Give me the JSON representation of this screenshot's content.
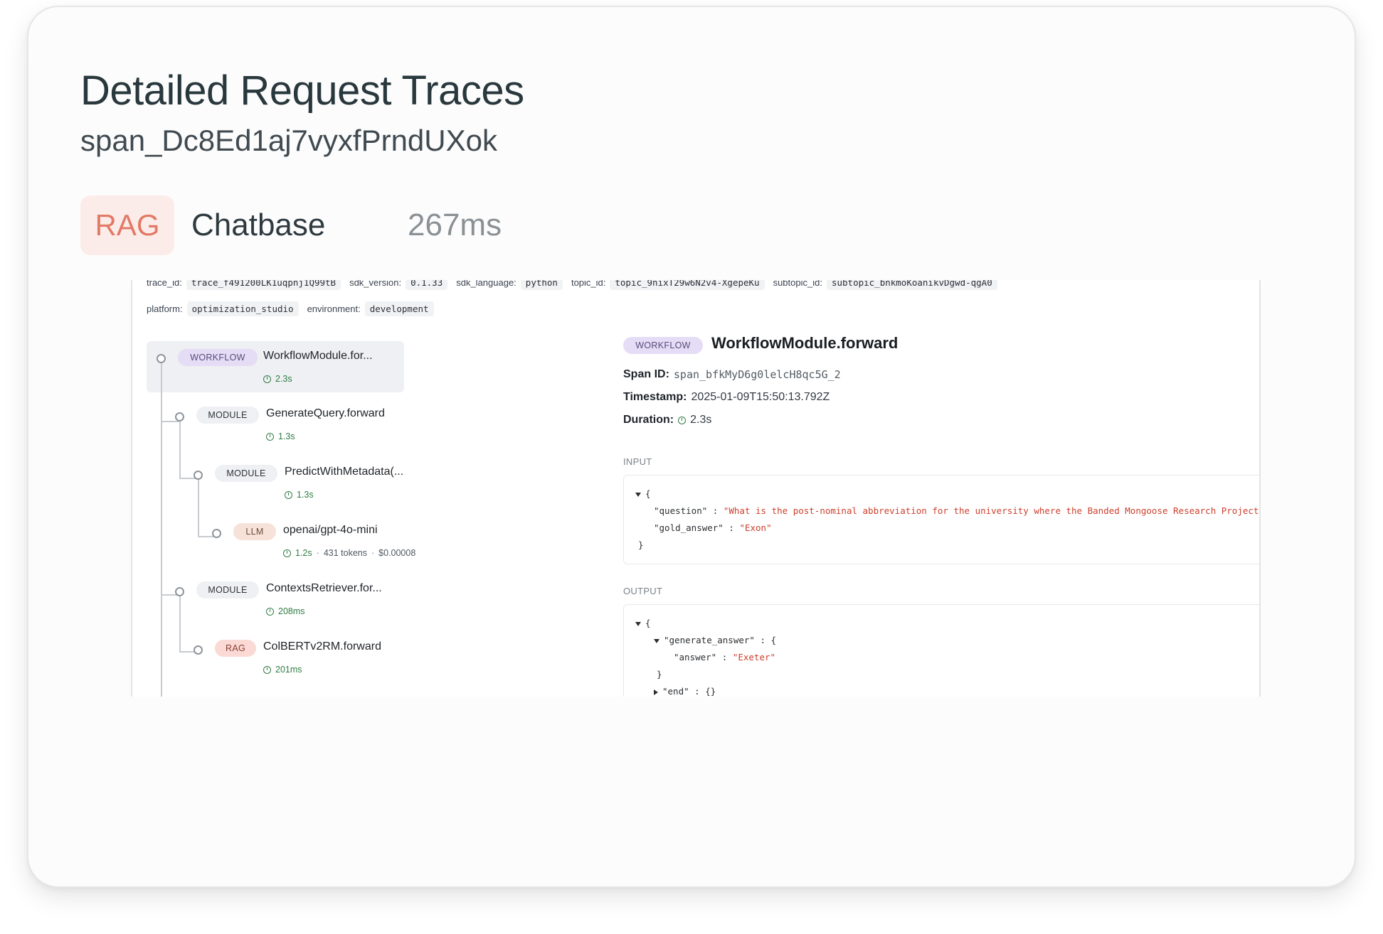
{
  "header": {
    "title": "Detailed Request Traces",
    "span_id": "span_Dc8Ed1aj7vyxfPrndUXok",
    "type_tag": "RAG",
    "app_name": "Chatbase",
    "latency": "267ms"
  },
  "meta": {
    "row1": [
      {
        "key": "trace_id:",
        "value": "trace_f491200LK1uqpnj1Q99tB"
      },
      {
        "key": "sdk_version:",
        "value": "0.1.33"
      },
      {
        "key": "sdk_language:",
        "value": "python"
      },
      {
        "key": "topic_id:",
        "value": "topic_9nixT29w6N2v4-XgepeKu"
      },
      {
        "key": "subtopic_id:",
        "value": "subtopic_bnkmoKoanikvDgwd-qgA0"
      }
    ],
    "row2": [
      {
        "key": "platform:",
        "value": "optimization_studio"
      },
      {
        "key": "environment:",
        "value": "development"
      }
    ]
  },
  "tree": {
    "nodes": [
      {
        "type": "WORKFLOW",
        "name": "WorkflowModule.for...",
        "duration": "2.3s"
      },
      {
        "type": "MODULE",
        "name": "GenerateQuery.forward",
        "duration": "1.3s"
      },
      {
        "type": "MODULE",
        "name": "PredictWithMetadata(...",
        "duration": "1.3s"
      },
      {
        "type": "LLM",
        "name": "openai/gpt-4o-mini",
        "duration": "1.2s",
        "tokens": "431 tokens",
        "cost": "$0.00008"
      },
      {
        "type": "MODULE",
        "name": "ContextsRetriever.for...",
        "duration": "208ms"
      },
      {
        "type": "RAG",
        "name": "ColBERTv2RM.forward",
        "duration": "201ms"
      }
    ],
    "separator": "·"
  },
  "detail": {
    "type": "WORKFLOW",
    "title": "WorkflowModule.forward",
    "span_id_label": "Span ID:",
    "span_id": "span_bfkMyD6g0lelcH8qc5G_2",
    "timestamp_label": "Timestamp:",
    "timestamp": "2025-01-09T15:50:13.792Z",
    "duration_label": "Duration:",
    "duration": "2.3s",
    "input_label": "INPUT",
    "output_label": "OUTPUT",
    "input": {
      "open_brace": "{",
      "close_brace": "}",
      "question_key": "\"question\"",
      "question_val": "\"What is the post-nominal abbreviation for the university where the Banded Mongoose Research Project is based?\"",
      "gold_key": "\"gold_answer\"",
      "gold_val": "\"Exon\"",
      "colon": ":"
    },
    "output": {
      "open_brace": "{",
      "gen_key": "\"generate_answer\"",
      "gen_open": "{",
      "answer_key": "\"answer\"",
      "answer_val": "\"Exeter\"",
      "gen_close": "}",
      "end_key": "\"end\"",
      "end_val": "{}",
      "colon": ":"
    },
    "icons": [
      "code-braces-icon",
      "copy-icon"
    ],
    "icon_glyphs": {
      "braces": "{}",
      "copy": "⧉"
    }
  },
  "colors": {
    "rag_bg": "#fcece9",
    "rag_text": "#e17a67",
    "workflow_badge": "#e5dcf6",
    "module_badge": "#eef0f3",
    "llm_badge": "#f6e2d8",
    "rag_badge": "#fbdad6",
    "duration_green": "#2f7d43",
    "json_string": "#cc3f2c"
  }
}
